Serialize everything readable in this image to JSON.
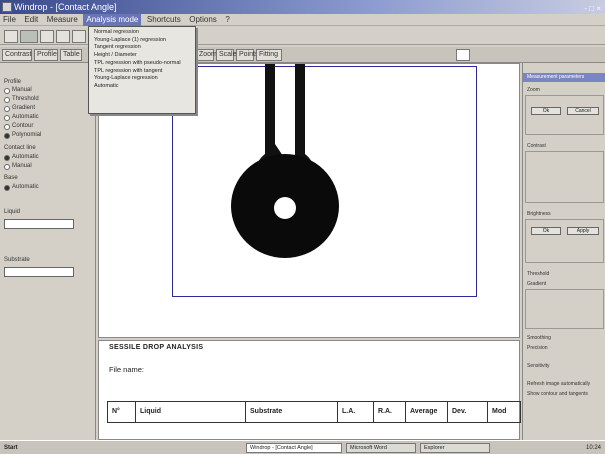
{
  "window": {
    "title": "Windrop - [Contact Angle]",
    "controls": "- □ ×"
  },
  "menu": [
    "File",
    "Edit",
    "Measure",
    "Analysis mode",
    "Shortcuts",
    "Options",
    "?"
  ],
  "menu_active_index": 3,
  "dropdown": [
    "Normal regression",
    "Young-Laplace (1) regression",
    "Tangent regression",
    "Height / Diameter",
    "TPL regression with pseudo-normal",
    "TPL regression with tangent",
    "Young-Laplace regression",
    "Automatic"
  ],
  "tabs": [
    "Contrast",
    "Profile",
    "Table",
    "Zoom",
    "Scale",
    "Points",
    "Fitting"
  ],
  "left": {
    "section_title": "Profile",
    "options": [
      "Manual",
      "Threshold",
      "Gradient",
      "Automatic",
      "Contour",
      "Polynomial"
    ],
    "contact_line_label": "Contact line",
    "contact_line_options": [
      "Automatic",
      "Manual"
    ],
    "base_label": "Base",
    "base_option": "Automatic",
    "field1_label": "Liquid",
    "field2_label": "Substrate"
  },
  "results": {
    "header": "SESSILE DROP ANALYSIS",
    "file_label": "File name:",
    "columns": [
      "N°",
      "Liquid",
      "Substrate",
      "L.A.",
      "R.A.",
      "Average",
      "Dev.",
      "Mod"
    ]
  },
  "right": {
    "panel_title": "Measurement parameters",
    "buttons": [
      "Ok",
      "Cancel",
      "Ok",
      "Apply"
    ],
    "labels": [
      "Zoom",
      "Contrast",
      "Brightness",
      "Threshold",
      "Gradient",
      "Smoothing",
      "Precision",
      "Sensitivity"
    ],
    "checkbox1": "Refresh image automatically",
    "checkbox2": "Show contour and tangents"
  },
  "taskbar": {
    "start": "Start",
    "items": [
      "Windrop - [Contact Angle]",
      "Microsoft Word",
      "Explorer"
    ],
    "clock": "10:24"
  }
}
